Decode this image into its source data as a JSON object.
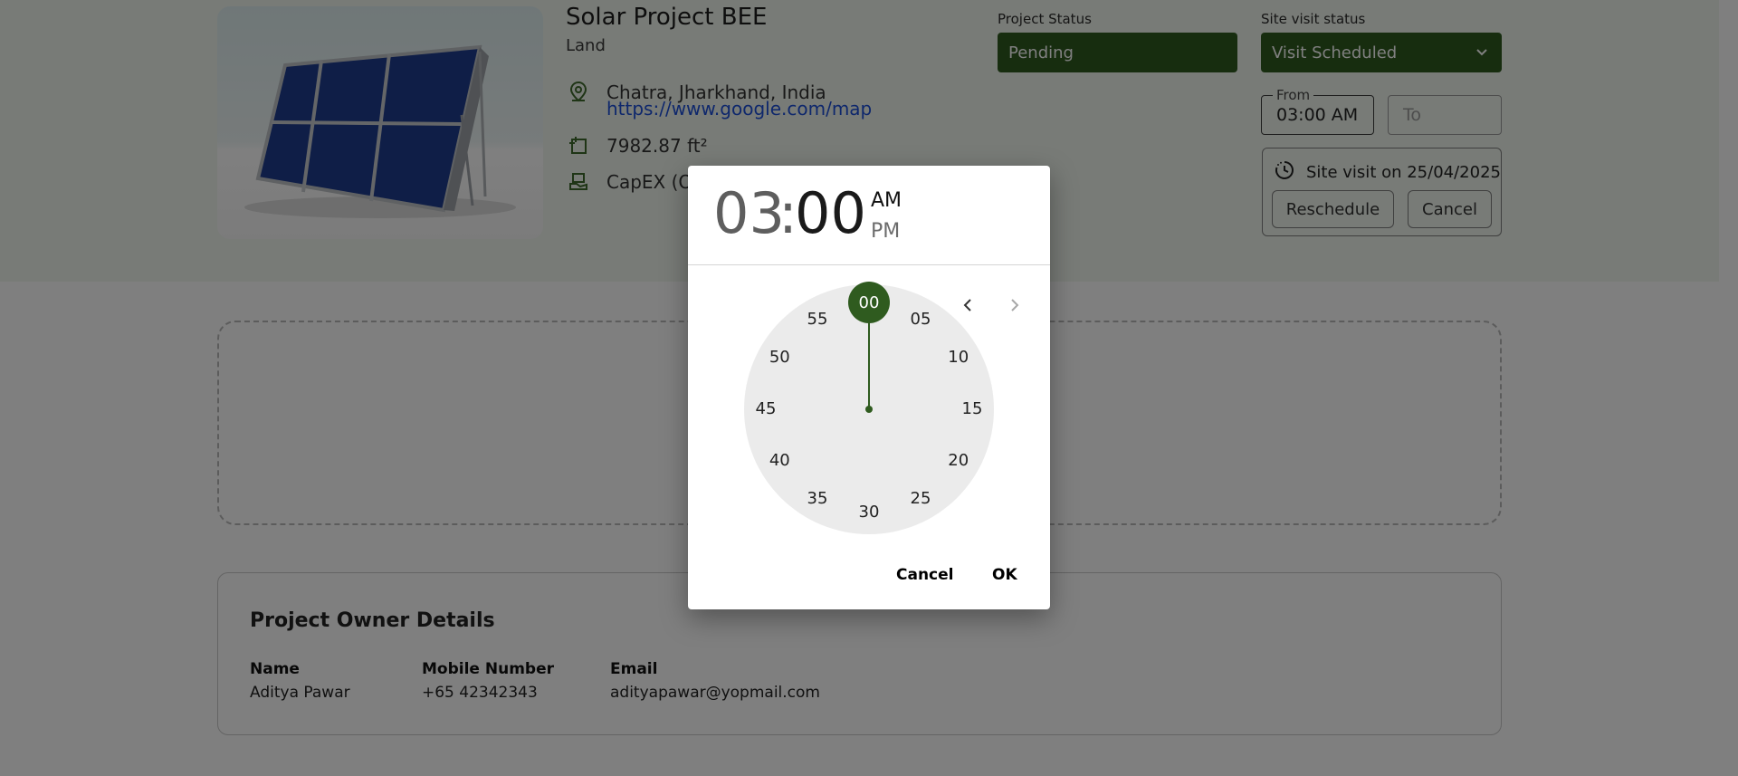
{
  "project": {
    "title": "Solar Project BEE",
    "type": "Land",
    "location": "Chatra, Jharkhand, India",
    "map_link": "https://www.google.com/map",
    "area": "7982.87 ft²",
    "finance": "CapEX (O"
  },
  "project_status": {
    "label": "Project Status",
    "value": "Pending"
  },
  "site_visit": {
    "label": "Site visit status",
    "value": "Visit Scheduled",
    "from_label": "From",
    "from_value": "03:00 AM",
    "to_placeholder": "To",
    "scheduled_text": "Site visit on 25/04/2025",
    "reschedule_label": "Reschedule",
    "cancel_label": "Cancel"
  },
  "owner": {
    "section_title": "Project Owner Details",
    "name_label": "Name",
    "name_value": "Aditya Pawar",
    "mobile_label": "Mobile Number",
    "mobile_value": "+65 42342343",
    "email_label": "Email",
    "email_value": "adityapawar@yopmail.com"
  },
  "time_picker": {
    "hours": "03",
    "separator": ":",
    "minutes": "00",
    "am_label": "AM",
    "pm_label": "PM",
    "selected_minute": "00",
    "clock_labels": [
      "05",
      "10",
      "15",
      "20",
      "25",
      "30",
      "35",
      "40",
      "45",
      "50",
      "55"
    ],
    "cancel_label": "Cancel",
    "ok_label": "OK"
  },
  "colors": {
    "accent": "#2f5b1f",
    "header_band": "#f1f7ef",
    "link": "#1d4fd8"
  },
  "icons": [
    "location-pin-icon",
    "area-icon",
    "finance-icon",
    "chevron-down-icon",
    "clock-history-icon",
    "chevron-left-icon",
    "chevron-right-icon"
  ]
}
